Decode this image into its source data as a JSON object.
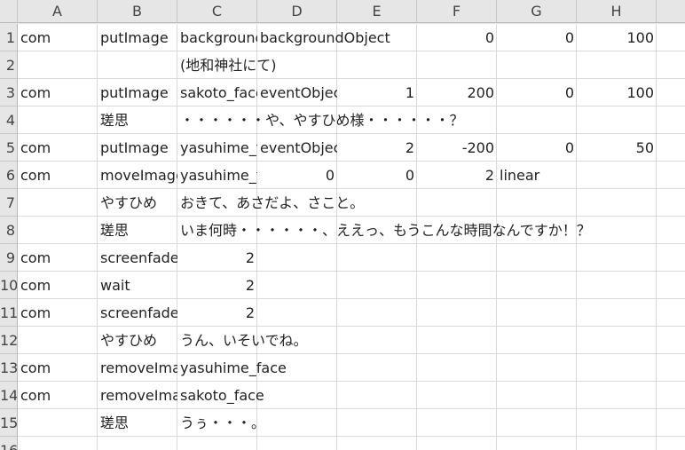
{
  "columns": [
    "A",
    "B",
    "C",
    "D",
    "E",
    "F",
    "G",
    "H"
  ],
  "rows": [
    "1",
    "2",
    "3",
    "4",
    "5",
    "6",
    "7",
    "8",
    "9",
    "10",
    "11",
    "12",
    "13",
    "14",
    "15",
    "16"
  ],
  "cells": {
    "r1": {
      "A": "com",
      "B": "putImage",
      "C": "backgroundImage",
      "D": "backgroundObject",
      "F": "0",
      "G": "0",
      "H": "100"
    },
    "r2": {
      "C": "(地和神社にて)"
    },
    "r3": {
      "A": "com",
      "B": "putImage",
      "C": "sakoto_face",
      "D": "eventObject",
      "E": "1",
      "F": "200",
      "G": "0",
      "H": "100"
    },
    "r4": {
      "B": "瑳思",
      "C": "・・・・・・や、やすひめ様・・・・・・？"
    },
    "r5": {
      "A": "com",
      "B": "putImage",
      "C": "yasuhime_face",
      "D": "eventObject",
      "E": "2",
      "F": "-200",
      "G": "0",
      "H": "50"
    },
    "r6": {
      "A": "com",
      "B": "moveImage",
      "C": "yasuhime_face",
      "D": "0",
      "E": "0",
      "F": "2",
      "G": "linear"
    },
    "r7": {
      "B": "やすひめ",
      "C": "おきて、あさだよ、さこと。"
    },
    "r8": {
      "B": "瑳思",
      "C": "いま何時・・・・・・、ええっ、もうこんな時間なんですか！？"
    },
    "r9": {
      "A": "com",
      "B": "screenfadeout",
      "C": "2"
    },
    "r10": {
      "A": "com",
      "B": "wait",
      "C": "2"
    },
    "r11": {
      "A": "com",
      "B": "screenfadein",
      "C": "2"
    },
    "r12": {
      "B": "やすひめ",
      "C": "うん、いそいでね。"
    },
    "r13": {
      "A": "com",
      "B": "removeImage",
      "C": "yasuhime_face"
    },
    "r14": {
      "A": "com",
      "B": "removeImage",
      "C": "sakoto_face"
    },
    "r15": {
      "B": "瑳思",
      "C": "うぅ・・・。"
    }
  }
}
